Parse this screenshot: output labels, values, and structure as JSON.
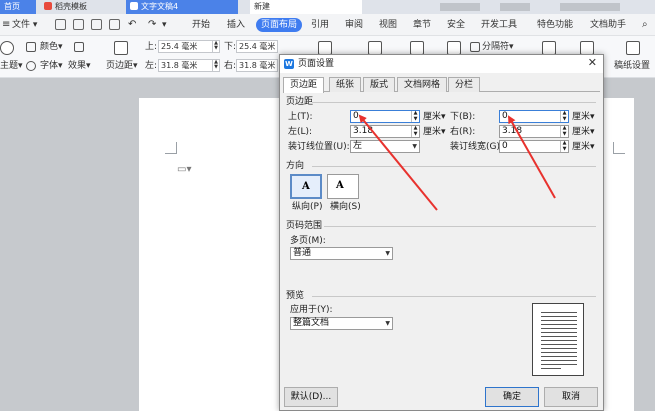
{
  "tabs": {
    "home": "首页",
    "doc1": "稻壳模板",
    "doc2": "文字文稿4",
    "doc3": "新建"
  },
  "menu": {
    "file": "文件",
    "items": [
      "开始",
      "插入",
      "页面布局",
      "引用",
      "审阅",
      "视图",
      "章节",
      "安全",
      "开发工具",
      "特色功能",
      "文档助手"
    ],
    "active": "页面布局"
  },
  "ribbon": {
    "theme": "主题",
    "colors": "颜色",
    "fonts": "字体",
    "effects": "效果",
    "margins": "页边距",
    "top_label": "上:",
    "top_value": "25.4 毫米",
    "bottom_label": "下:",
    "bottom_value": "25.4 毫米",
    "left_label": "左:",
    "left_value": "31.8 毫米",
    "right_label": "右:",
    "right_value": "31.8 毫米",
    "separator": "分隔符",
    "paper_bg": "稿纸设置"
  },
  "dialog": {
    "title": "页面设置",
    "tabs": [
      "页边距",
      "纸张",
      "版式",
      "文档网格",
      "分栏"
    ],
    "active_tab": "页边距",
    "margins_group": "页边距",
    "top_label": "上(T):",
    "top_value": "0",
    "bottom_label": "下(B):",
    "bottom_value": "0",
    "left_label": "左(L):",
    "left_value": "3.18",
    "right_label": "右(R):",
    "right_value": "3.18",
    "unit": "厘米",
    "gutter_pos_label": "装订线位置(U):",
    "gutter_pos_value": "左",
    "gutter_width_label": "装订线宽(G):",
    "gutter_width_value": "0",
    "orientation_group": "方向",
    "portrait": "纵向(P)",
    "landscape": "横向(S)",
    "pages_group": "页码范围",
    "multiple_pages_label": "多页(M):",
    "multiple_pages_value": "普通",
    "preview_group": "预览",
    "apply_to_label": "应用于(Y):",
    "apply_to_value": "整篇文档",
    "default_btn": "默认(D)...",
    "ok_btn": "确定",
    "cancel_btn": "取消"
  },
  "colors": {
    "accent": "#3f7cf0",
    "annotation_arrow": "#e8322e"
  }
}
